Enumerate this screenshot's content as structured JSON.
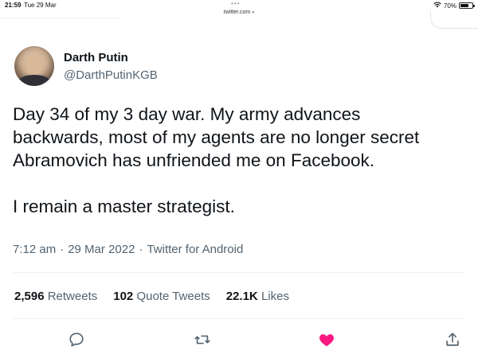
{
  "status_bar": {
    "time": "21:59",
    "date": "Tue 29 Mar",
    "battery": "70%",
    "battery_level": 0.7
  },
  "browser": {
    "url": "twitter.com"
  },
  "tweet": {
    "author": {
      "display_name": "Darth Putin",
      "handle": "@DarthPutinKGB"
    },
    "text_paragraph_1": "Day 34 of my 3 day war. My army advances backwards, most of my agents are no longer secret Abramovich has unfriended me on Facebook.",
    "text_paragraph_1_lines": [
      "Day 34 of my 3 day war. My army advances",
      "backwards, most of my agents are no longer secret",
      "Abramovich has unfriended me on Facebook."
    ],
    "text_paragraph_2": "I remain a master strategist.",
    "time": "7:12 am",
    "date": "29 Mar 2022",
    "source": "Twitter for Android"
  },
  "stats": {
    "retweets_count": "2,596",
    "retweets_label": "Retweets",
    "quote_count": "102",
    "quote_label": "Quote Tweets",
    "likes_count": "22.1K",
    "likes_label": "Likes"
  },
  "actions": {
    "reply_icon": "reply-icon",
    "retweet_icon": "retweet-icon",
    "like_icon": "heart-icon",
    "share_icon": "share-icon",
    "liked_color": "#f91880",
    "icon_color": "#536471"
  }
}
